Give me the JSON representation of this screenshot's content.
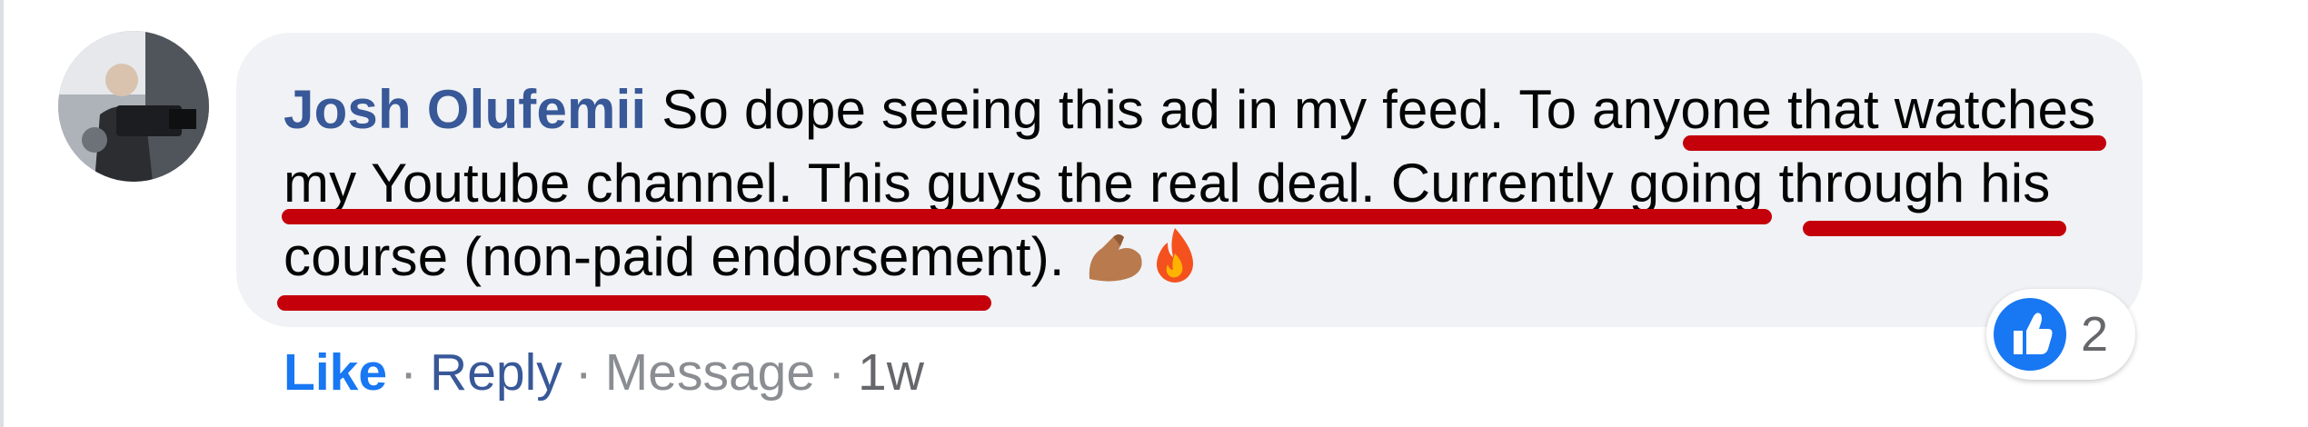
{
  "comment": {
    "author": "Josh Olufemii",
    "text": "So dope seeing this ad in my feed. To anyone that watches my Youtube channel. This guys the real deal. Currently going through his course (non-paid endorsement).",
    "emoji_icons": [
      "flexed-biceps-icon",
      "fire-icon"
    ]
  },
  "actions": {
    "like": "Like",
    "reply": "Reply",
    "message": "Message",
    "time": "1w",
    "separator": "·"
  },
  "reactions": {
    "icon": "thumbs-up-icon",
    "count": "2"
  },
  "colors": {
    "author": "#385898",
    "like": "#1877f2",
    "underline_annotation": "#c4000b",
    "bubble": "#f0f2f5"
  }
}
